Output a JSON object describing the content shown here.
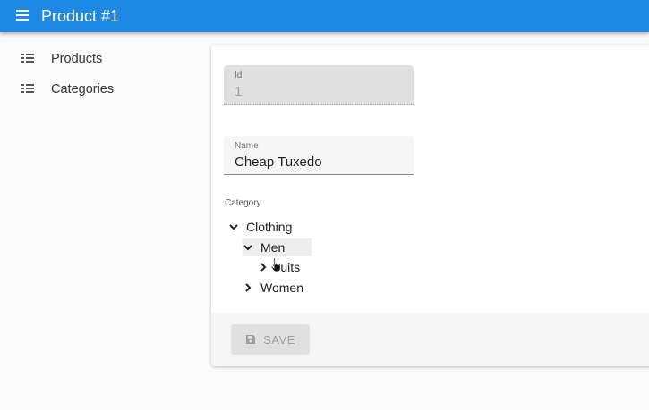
{
  "appbar": {
    "title": "Product #1",
    "menu_icon": "hamburger-menu-icon",
    "color": "#1e88e5"
  },
  "sidebar": {
    "items": [
      {
        "label": "Products",
        "icon": "list-icon"
      },
      {
        "label": "Categories",
        "icon": "list-icon"
      }
    ]
  },
  "form": {
    "id_field": {
      "label": "Id",
      "value": "1"
    },
    "name_field": {
      "label": "Name",
      "value": "Cheap Tuxedo"
    },
    "category": {
      "label": "Category",
      "tree": [
        {
          "label": "Clothing",
          "expanded": true
        },
        {
          "label": "Men",
          "expanded": true,
          "selected": true
        },
        {
          "label": "Suits",
          "expanded": false
        },
        {
          "label": "Women",
          "expanded": false
        }
      ]
    },
    "save_label": "SAVE"
  }
}
